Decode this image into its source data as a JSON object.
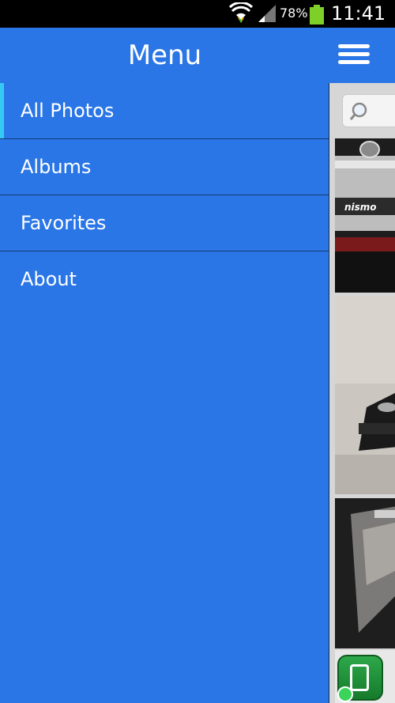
{
  "status_bar": {
    "battery_percent": "78%",
    "time": "11:41",
    "icons": [
      "wifi-icon",
      "signal-icon",
      "battery-icon"
    ]
  },
  "app_bar": {
    "title": "Menu",
    "menu_icon": "hamburger-menu-icon"
  },
  "drawer": {
    "items": [
      {
        "label": "All Photos",
        "active": true
      },
      {
        "label": "Albums",
        "active": false
      },
      {
        "label": "Favorites",
        "active": false
      },
      {
        "label": "About",
        "active": false
      }
    ]
  },
  "content": {
    "search_icon": "search-icon",
    "thumb_1_label": "nismo"
  },
  "colors": {
    "primary": "#2a76e6",
    "active_indicator": "#36c9f2",
    "divider": "#163a73",
    "status_bar": "#000000",
    "battery": "#7fcf2a"
  }
}
